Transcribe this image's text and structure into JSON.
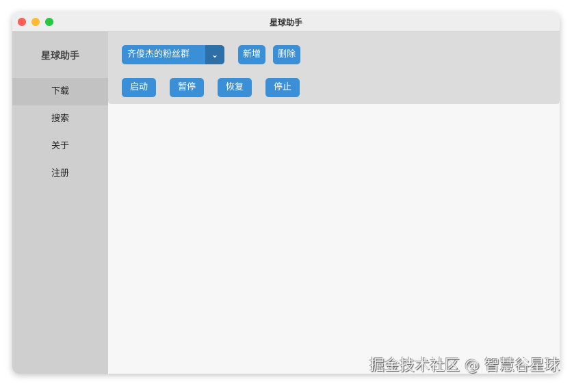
{
  "window": {
    "title": "星球助手"
  },
  "sidebar": {
    "brand": "星球助手",
    "items": [
      {
        "label": "下载"
      },
      {
        "label": "搜索"
      },
      {
        "label": "关于"
      },
      {
        "label": "注册"
      }
    ]
  },
  "toolbar": {
    "group_select": "齐俊杰的粉丝群",
    "add": "新增",
    "delete": "删除",
    "start": "启动",
    "pause": "暂停",
    "resume": "恢复",
    "stop": "停止"
  },
  "watermark": "掘金技术社区 @ 智慧谷星球",
  "colors": {
    "accent": "#3a8fd6",
    "sidebar": "#cfcfcf"
  }
}
